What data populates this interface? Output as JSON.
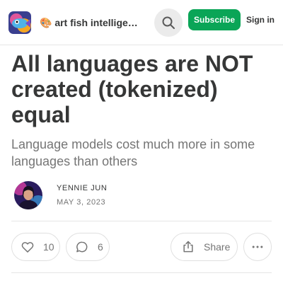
{
  "header": {
    "publication_name": "🎨 art fish intelligence",
    "subscribe_label": "Subscribe",
    "signin_label": "Sign in",
    "search_icon": "search-icon"
  },
  "post": {
    "title": "All languages are NOT created (tokenized) equal",
    "subtitle": "Language models cost much more in some languages than others",
    "author": "YENNIE JUN",
    "date": "MAY 3, 2023"
  },
  "actions": {
    "like_count": "10",
    "comment_count": "6",
    "share_label": "Share",
    "icons": [
      "heart-icon",
      "comment-icon",
      "share-icon",
      "more-icon"
    ]
  },
  "colors": {
    "accent": "#0aa557",
    "text": "#363737",
    "muted": "#757575"
  }
}
